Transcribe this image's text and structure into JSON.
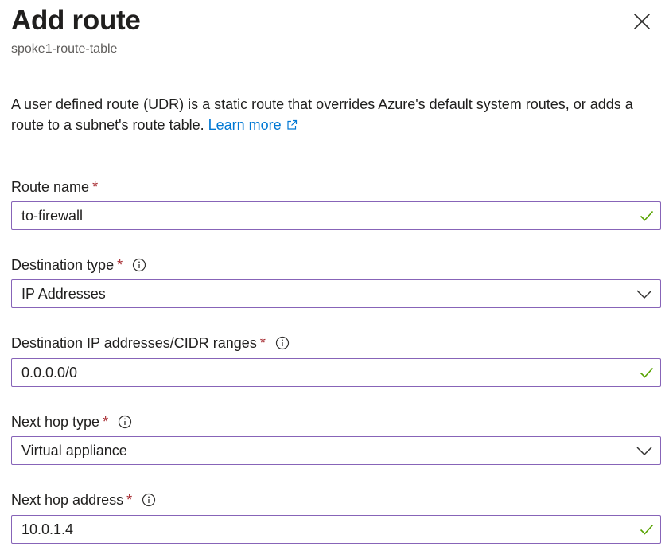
{
  "header": {
    "title": "Add route",
    "subtitle": "spoke1-route-table"
  },
  "description": {
    "text": "A user defined route (UDR) is a static route that overrides Azure's default system routes, or adds a route to a subnet's route table.",
    "link_label": "Learn more"
  },
  "fields": {
    "route_name": {
      "label": "Route name",
      "required_mark": "*",
      "value": "to-firewall"
    },
    "destination_type": {
      "label": "Destination type",
      "required_mark": "*",
      "value": "IP Addresses"
    },
    "destination_ip": {
      "label": "Destination IP addresses/CIDR ranges",
      "required_mark": "*",
      "value": "0.0.0.0/0"
    },
    "next_hop_type": {
      "label": "Next hop type",
      "required_mark": "*",
      "value": "Virtual appliance"
    },
    "next_hop_address": {
      "label": "Next hop address",
      "required_mark": "*",
      "value": "10.0.1.4"
    }
  },
  "icons": {
    "close": "close-icon",
    "external_link": "external-link-icon",
    "info": "info-icon",
    "valid": "checkmark-icon",
    "dropdown": "chevron-down-icon"
  },
  "colors": {
    "link": "#0078d4",
    "required": "#a4262c",
    "input_border": "#8764b8",
    "valid": "#57a300",
    "subtitle": "#605e5c"
  }
}
